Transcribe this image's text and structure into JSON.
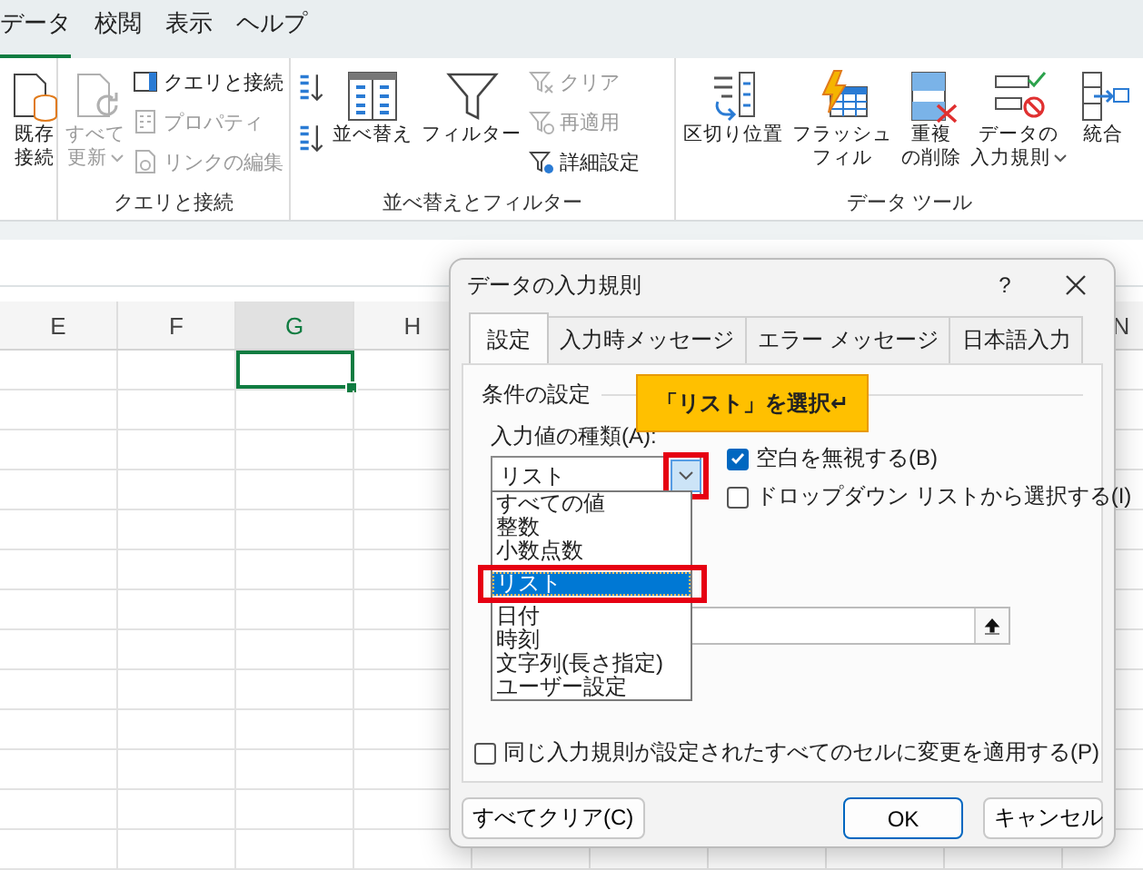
{
  "ribbon_tabs": [
    {
      "label": "データ",
      "selected": true
    },
    {
      "label": "校閲",
      "selected": false
    },
    {
      "label": "表示",
      "selected": false
    },
    {
      "label": "ヘルプ",
      "selected": false
    }
  ],
  "ribbon_groups": [
    {
      "columns": [
        [
          {
            "kind": "large",
            "lines": [
              "既存",
              "接続"
            ],
            "disabled": false
          }
        ]
      ]
    },
    {
      "label": "クエリと接続",
      "columns": [
        [
          {
            "kind": "large",
            "lines": [
              "すべて",
              "更新"
            ],
            "disabled": true,
            "dropdown": true
          }
        ],
        [
          {
            "kind": "small",
            "lines": [
              "クエリと接続"
            ],
            "disabled": false
          },
          {
            "kind": "small",
            "lines": [
              "プロパティ"
            ],
            "disabled": true
          },
          {
            "kind": "small",
            "lines": [
              "リンクの編集"
            ],
            "disabled": true
          }
        ]
      ]
    },
    {
      "label": "並べ替えとフィルター",
      "columns": [
        [
          {
            "kind": "icon",
            "disabled": false
          },
          {
            "kind": "icon",
            "disabled": false
          }
        ],
        [
          {
            "kind": "large",
            "lines": [
              "並べ替え"
            ],
            "disabled": false
          }
        ],
        [
          {
            "kind": "large",
            "lines": [
              "フィルター"
            ],
            "disabled": false
          }
        ],
        [
          {
            "kind": "small",
            "lines": [
              "クリア"
            ],
            "disabled": true
          },
          {
            "kind": "small",
            "lines": [
              "再適用"
            ],
            "disabled": true
          },
          {
            "kind": "small",
            "lines": [
              "詳細設定"
            ],
            "disabled": false
          }
        ]
      ]
    },
    {
      "label": "データ ツール",
      "columns": [
        [
          {
            "kind": "large",
            "lines": [
              "区切り位置"
            ],
            "disabled": false
          }
        ],
        [
          {
            "kind": "large",
            "lines": [
              "フラッシュ",
              "フィル"
            ],
            "disabled": false
          }
        ],
        [
          {
            "kind": "large",
            "lines": [
              "重複",
              "の削除"
            ],
            "disabled": false
          }
        ],
        [
          {
            "kind": "large",
            "lines": [
              "データの",
              "入力規則"
            ],
            "disabled": false,
            "dropdown": true
          }
        ],
        [
          {
            "kind": "large",
            "lines": [
              "統合"
            ],
            "disabled": false
          }
        ]
      ]
    }
  ],
  "sheet": {
    "columns": [
      {
        "label": "E",
        "selected": false
      },
      {
        "label": "F",
        "selected": false
      },
      {
        "label": "G",
        "selected": true
      },
      {
        "label": "H",
        "selected": false
      },
      {
        "label": "N",
        "selected": false
      }
    ]
  },
  "dialog": {
    "title": "データの入力規則",
    "help": "?",
    "tabs": [
      {
        "label": "設定",
        "selected": true
      },
      {
        "label": "入力時メッセージ",
        "selected": false
      },
      {
        "label": "エラー メッセージ",
        "selected": false
      },
      {
        "label": "日本語入力",
        "selected": false
      }
    ],
    "section": "条件の設定",
    "type_label": "入力値の種類(A):",
    "type_value": "リスト",
    "type_options": [
      {
        "label": "すべての値",
        "selected": false
      },
      {
        "label": "整数",
        "selected": false
      },
      {
        "label": "小数点数",
        "selected": false
      },
      {
        "label": "リスト",
        "selected": true
      },
      {
        "label": "日付",
        "selected": false
      },
      {
        "label": "時刻",
        "selected": false
      },
      {
        "label": "文字列(長さ指定)",
        "selected": false
      },
      {
        "label": "ユーザー設定",
        "selected": false
      }
    ],
    "checkboxes": [
      {
        "label": "空白を無視する(B)",
        "checked": true
      },
      {
        "label": "ドロップダウン リストから選択する(I)",
        "checked": false
      }
    ],
    "apply_all": {
      "label": "同じ入力規則が設定されたすべてのセルに変更を適用する(P)",
      "checked": false
    },
    "buttons": [
      {
        "label": "すべてクリア(C)",
        "default": false
      },
      {
        "label": "OK",
        "default": true
      },
      {
        "label": "キャンセル",
        "default": false
      }
    ]
  },
  "callout": {
    "text": "「リスト」を選択↵"
  }
}
